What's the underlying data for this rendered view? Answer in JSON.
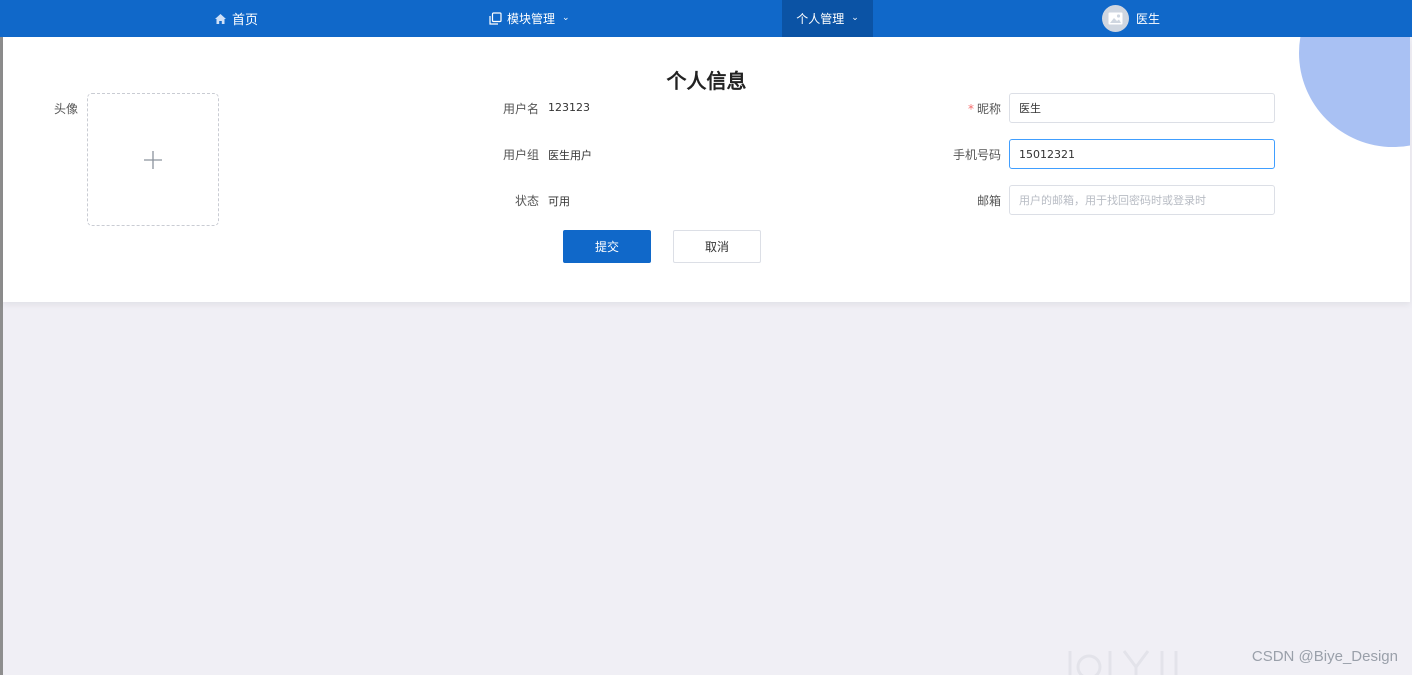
{
  "nav": {
    "home": "首页",
    "modules": "模块管理",
    "personal": "个人管理",
    "user_name": "医生"
  },
  "page_title": "个人信息",
  "avatar": {
    "label": "头像"
  },
  "info": {
    "username_label": "用户名",
    "username_value": "123123",
    "group_label": "用户组",
    "group_value": "医生用户",
    "status_label": "状态",
    "status_value": "可用"
  },
  "form": {
    "nickname_label": "昵称",
    "nickname_value": "医生",
    "phone_label": "手机号码",
    "phone_value": "15012321",
    "email_label": "邮箱",
    "email_placeholder": "用户的邮箱，用于找回密码时或登录时"
  },
  "buttons": {
    "submit": "提交",
    "cancel": "取消"
  },
  "watermark": "CSDN @Biye_Design",
  "colors": {
    "primary": "#1068c9",
    "active_nav": "#0b53a5",
    "required": "#f56c6c",
    "decor": "#a9c1f3"
  },
  "icons": {
    "home": "home-icon",
    "modules": "copy-icon",
    "avatar": "image-icon",
    "upload": "plus-icon"
  }
}
